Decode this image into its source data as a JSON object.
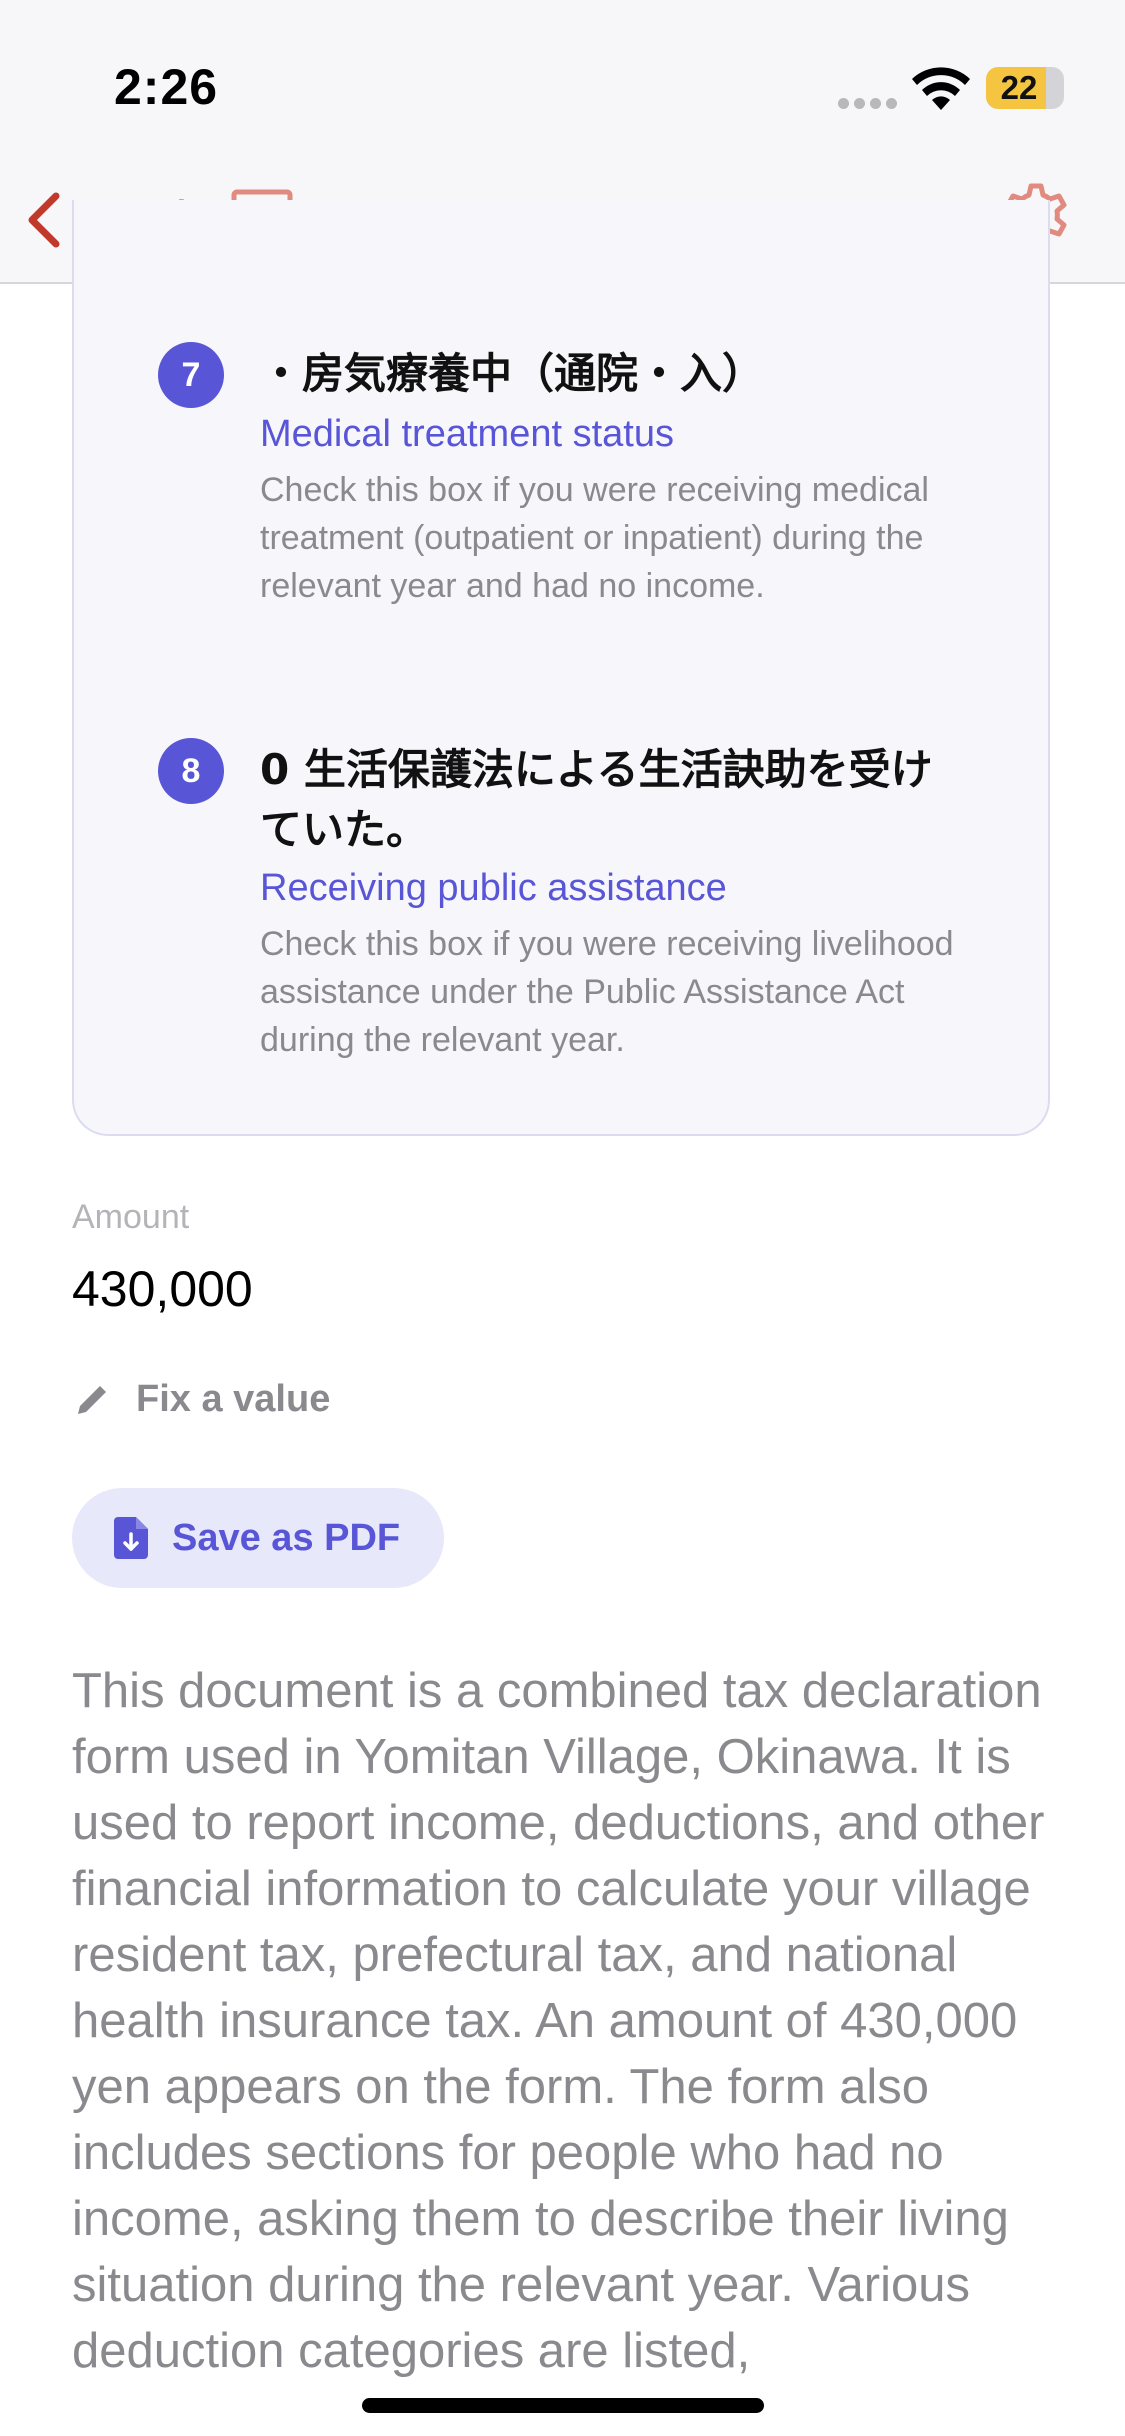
{
  "status_bar": {
    "time": "2:26",
    "battery_level": "22",
    "battery_color": "#f5c542"
  },
  "nav": {
    "back_label": "Back",
    "accent_color": "#c0392b"
  },
  "card": {
    "items": [
      {
        "number": "7",
        "title_jp": "・房気療養中（通院・入）",
        "title_en": "Medical treatment status",
        "description": "Check this box if you were receiving medical treatment (outpatient or inpatient) during the relevant year and had no income."
      },
      {
        "number": "8",
        "title_jp": "0 生活保護法による生活訣助を受けていた。",
        "title_en": "Receiving public assistance",
        "description": "Check this box if you were receiving livelihood assistance under the Public Assistance Act during the relevant year."
      }
    ]
  },
  "amount": {
    "label": "Amount",
    "value": "430,000"
  },
  "fix_value_label": "Fix a value",
  "save_pdf_label": "Save as PDF",
  "summary": "This document is a combined tax declaration form used in Yomitan Village, Okinawa. It is used to report income, deductions, and other financial information to calculate your village resident tax, prefectural tax, and national health insurance tax. An amount of 430,000 yen appears on the form. The form also includes sections for people who had no income, asking them to describe their living situation during the relevant year. Various deduction categories are listed,",
  "colors": {
    "primary": "#5856d6",
    "muted_text": "#8a8a8e"
  }
}
